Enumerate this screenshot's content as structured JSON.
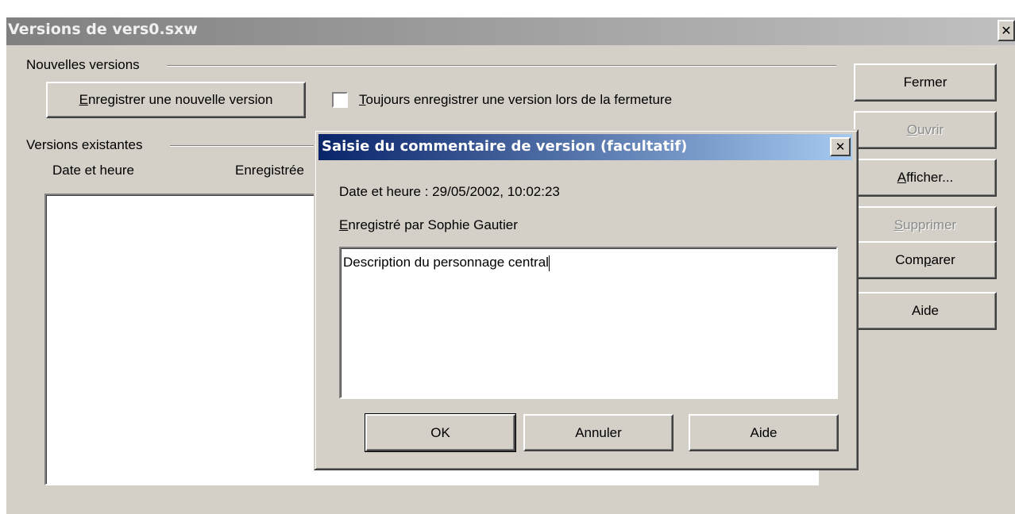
{
  "window": {
    "title": "Versions de vers0.sxw",
    "close_glyph": "✕"
  },
  "new_versions": {
    "group_label": "Nouvelles versions",
    "save_button": {
      "accel": "E",
      "rest": "nregistrer une nouvelle version"
    },
    "always_save": {
      "accel": "T",
      "rest": "oujours enregistrer une version lors de la fermeture",
      "checked": false
    }
  },
  "existing_versions": {
    "group_label": "Versions existantes",
    "columns": [
      "Date et heure",
      "Enregistrée"
    ]
  },
  "side_buttons": {
    "close": "Fermer",
    "open": {
      "accel": "O",
      "rest": "uvrir"
    },
    "show": {
      "accel": "A",
      "rest": "fficher..."
    },
    "delete": {
      "accel": "S",
      "rest": "upprimer"
    },
    "compare": {
      "pre": "Com",
      "accel": "p",
      "rest": "arer"
    },
    "help": "Aide"
  },
  "dialog": {
    "title": "Saisie du commentaire de version (facultatif)",
    "close_glyph": "✕",
    "datetime_label": "Date et heure : 29/05/2002, 10:02:23",
    "saved_by": {
      "accel": "E",
      "rest": "nregistré par  Sophie Gautier"
    },
    "comment_value": "Description du personnage central",
    "buttons": {
      "ok": "OK",
      "cancel": "Annuler",
      "help": "Aide"
    }
  }
}
